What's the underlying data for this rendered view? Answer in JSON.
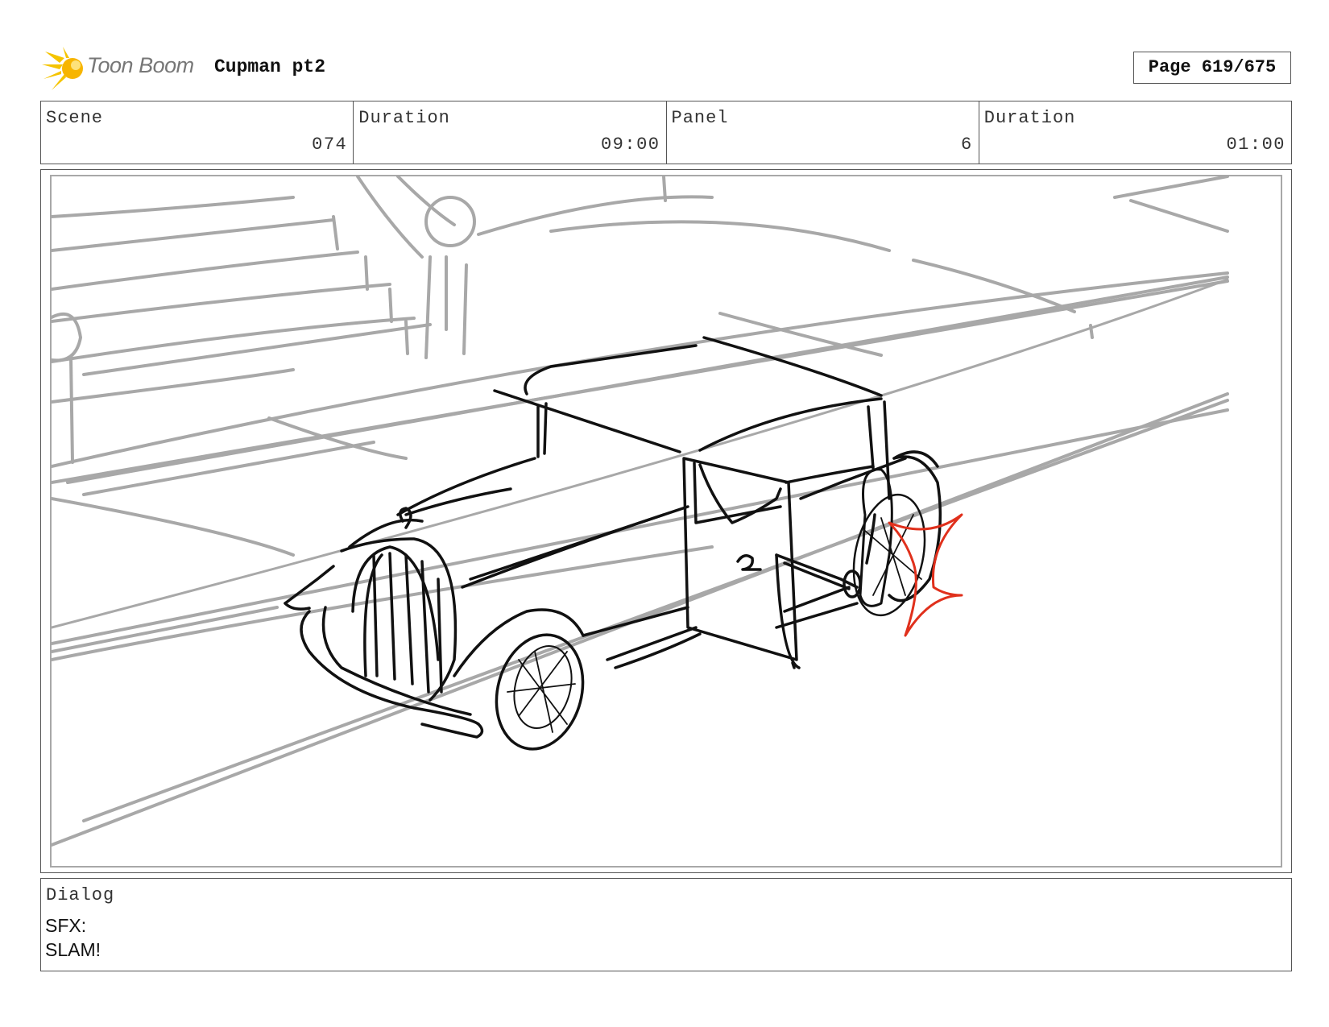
{
  "header": {
    "logo_text": "Toon Boom",
    "project_title": "Cupman pt2",
    "page_label": "Page 619/675"
  },
  "info": {
    "scene_label": "Scene",
    "scene_value": "074",
    "scene_duration_label": "Duration",
    "scene_duration_value": "09:00",
    "panel_label": "Panel",
    "panel_value": "6",
    "panel_duration_label": "Duration",
    "panel_duration_value": "01:00"
  },
  "dialog": {
    "label": "Dialog",
    "lines": [
      "SFX:",
      "SLAM!"
    ]
  },
  "colors": {
    "sketch_black": "#111111",
    "sketch_grey": "#a8a8a8",
    "impact_red": "#e0301c",
    "logo_yellow": "#f5c400"
  },
  "icons": {
    "logo": "toon-boom-sun-icon",
    "artwork": "storyboard-sketch-car-door-slam"
  }
}
